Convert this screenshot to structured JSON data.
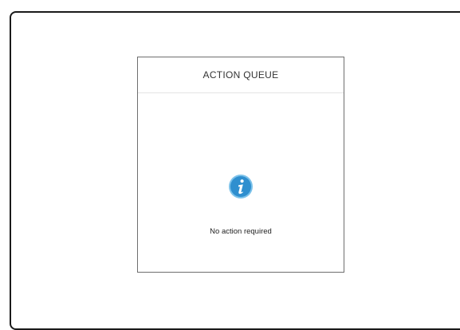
{
  "panel": {
    "title": "ACTION QUEUE",
    "status_text": "No action required",
    "icon": "info-icon"
  },
  "colors": {
    "info_icon_fill": "#2f8fcf",
    "info_icon_ring": "#7cc2ea",
    "frame_border": "#1a1a1a",
    "panel_border": "#6e6e6e"
  }
}
